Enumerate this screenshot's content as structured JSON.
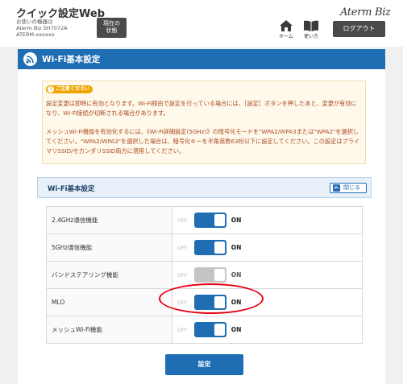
{
  "header": {
    "app_title": "クイック設定Web",
    "device_line1": "お使いの機器は",
    "device_line2": "Aterm Biz SH7072A",
    "device_line3": "ATERM-xxxxxx",
    "status_button_line1": "現在の",
    "status_button_line2": "状態",
    "brand": "Aterm Biz",
    "home_label": "ホーム",
    "howto_label": "使い方",
    "logout_label": "ログアウト"
  },
  "page": {
    "title": "Wi-Fi基本設定",
    "accent_color": "#1f6db3"
  },
  "caution": {
    "badge": "ご注意ください",
    "paragraph1": "設定変更は即時に有効となります。Wi-Fi経由で設定を行っている場合には、［設定］ボタンを押したあと、変更が有効になり、Wi-Fi接続が切断される場合があります。",
    "paragraph2": "メッシュWi-Fi機能を有効化するには、《Wi-Fi詳細設定(5GHz)》の暗号化モードを\"WPA2/WPA3または\"WPA2\"を選択してください。\"WPA2/WPA3\"を選択した場合は、暗号化キーを半角英数63桁以下に設定してください。この設定はプライマリSSID/セカンダリSSID両方に適用してください。"
  },
  "section": {
    "title": "Wi-Fi基本設定",
    "close_label": "閉じる"
  },
  "settings": [
    {
      "label": "2.4GHz通信機能",
      "off": "OFF",
      "on": "ON",
      "state": "on"
    },
    {
      "label": "5GHz通信機能",
      "off": "OFF",
      "on": "ON",
      "state": "on"
    },
    {
      "label": "バンドステアリング機能",
      "off": "OFF",
      "on": "ON",
      "state": "disabled"
    },
    {
      "label": "MLO",
      "off": "OFF",
      "on": "ON",
      "state": "on"
    },
    {
      "label": "メッシュWi-Fi機能",
      "off": "OFF",
      "on": "ON",
      "state": "on"
    }
  ],
  "submit_label": "設定",
  "highlight_color": "#e60012"
}
